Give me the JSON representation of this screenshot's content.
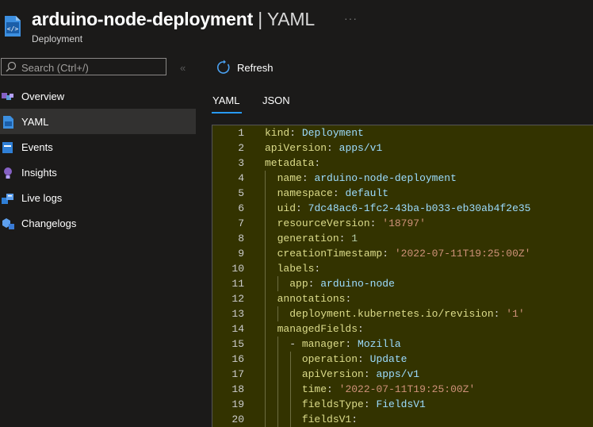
{
  "header": {
    "resource_name": "arduino-node-deployment",
    "separator": "|",
    "view_name": "YAML",
    "more": "···",
    "subtitle": "Deployment",
    "icon": "deployment-yaml-icon"
  },
  "search": {
    "placeholder": "Search (Ctrl+/)",
    "collapse": "«"
  },
  "sidebar": {
    "items": [
      {
        "label": "Overview",
        "icon": "overview-icon",
        "selected": false
      },
      {
        "label": "YAML",
        "icon": "yaml-icon",
        "selected": true
      },
      {
        "label": "Events",
        "icon": "events-icon",
        "selected": false
      },
      {
        "label": "Insights",
        "icon": "insights-icon",
        "selected": false
      },
      {
        "label": "Live logs",
        "icon": "live-logs-icon",
        "selected": false
      },
      {
        "label": "Changelogs",
        "icon": "changelogs-icon",
        "selected": false
      }
    ]
  },
  "toolbar": {
    "refresh_label": "Refresh"
  },
  "tabs": [
    {
      "label": "YAML",
      "active": true
    },
    {
      "label": "JSON",
      "active": false
    }
  ],
  "colors": {
    "accent": "#2899f5",
    "editor_bg": "#333300",
    "key": "#dcdc8b"
  },
  "yaml_lines": [
    {
      "n": "1",
      "indent": "",
      "key": "kind",
      "value": "Deployment"
    },
    {
      "n": "2",
      "indent": "",
      "key": "apiVersion",
      "value": "apps/v1"
    },
    {
      "n": "3",
      "indent": "",
      "key": "metadata",
      "value": ""
    },
    {
      "n": "4",
      "indent": "  ",
      "key": "name",
      "value": "arduino-node-deployment"
    },
    {
      "n": "5",
      "indent": "  ",
      "key": "namespace",
      "value": "default"
    },
    {
      "n": "6",
      "indent": "  ",
      "key": "uid",
      "value": "7dc48ac6-1fc2-43ba-b033-eb30ab4f2e35"
    },
    {
      "n": "7",
      "indent": "  ",
      "key": "resourceVersion",
      "value": "'18797'"
    },
    {
      "n": "8",
      "indent": "  ",
      "key": "generation",
      "value": "1"
    },
    {
      "n": "9",
      "indent": "  ",
      "key": "creationTimestamp",
      "value": "'2022-07-11T19:25:00Z'"
    },
    {
      "n": "10",
      "indent": "  ",
      "key": "labels",
      "value": ""
    },
    {
      "n": "11",
      "indent": "    ",
      "key": "app",
      "value": "arduino-node"
    },
    {
      "n": "12",
      "indent": "  ",
      "key": "annotations",
      "value": ""
    },
    {
      "n": "13",
      "indent": "    ",
      "key": "deployment.kubernetes.io/revision",
      "value": "'1'"
    },
    {
      "n": "14",
      "indent": "  ",
      "key": "managedFields",
      "value": ""
    },
    {
      "n": "15",
      "indent": "    - ",
      "key": "manager",
      "value": "Mozilla"
    },
    {
      "n": "16",
      "indent": "      ",
      "key": "operation",
      "value": "Update"
    },
    {
      "n": "17",
      "indent": "      ",
      "key": "apiVersion",
      "value": "apps/v1"
    },
    {
      "n": "18",
      "indent": "      ",
      "key": "time",
      "value": "'2022-07-11T19:25:00Z'"
    },
    {
      "n": "19",
      "indent": "      ",
      "key": "fieldsType",
      "value": "FieldsV1"
    },
    {
      "n": "20",
      "indent": "      ",
      "key": "fieldsV1",
      "value": ""
    }
  ]
}
